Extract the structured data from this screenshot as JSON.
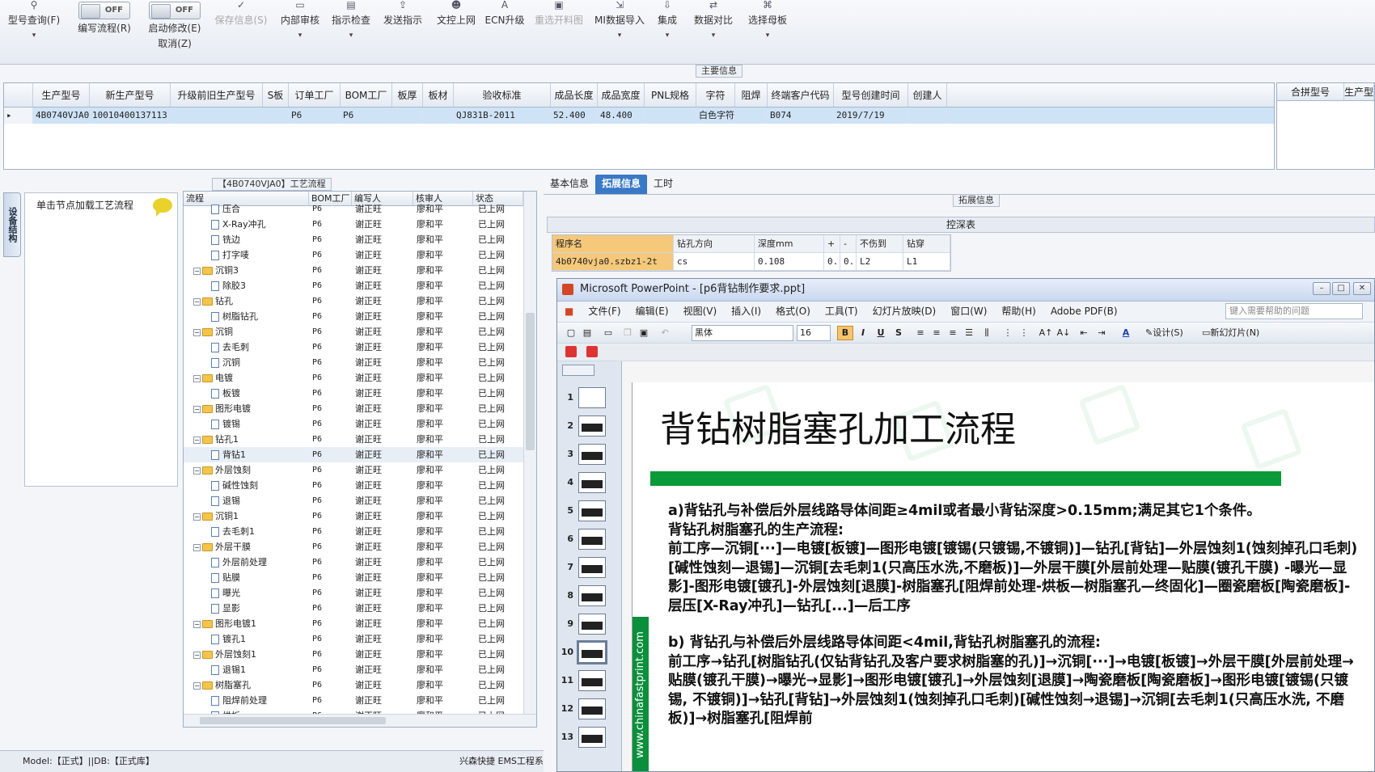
{
  "toolbar": {
    "items": [
      {
        "label": "型号查询(F)",
        "icon": "magnifier-icon",
        "arrow": "▾",
        "enabled": true
      },
      {
        "label": "编写流程(R)",
        "toggle": "OFF",
        "enabled": true
      },
      {
        "label": "启动修改(E)",
        "label2": "取消(Z)",
        "toggle": "OFF",
        "enabled": true
      },
      {
        "label": "保存信息(S)",
        "icon": "check-icon",
        "enabled": false
      },
      {
        "label": "内部审核",
        "icon": "printer-icon",
        "arrow": "▾",
        "enabled": true
      },
      {
        "label": "指示检查",
        "icon": "doc-check-icon",
        "arrow": "▾",
        "enabled": true
      },
      {
        "label": "发送指示",
        "icon": "upload-icon",
        "enabled": true
      },
      {
        "label": "文控上网",
        "icon": "users-icon",
        "enabled": true
      },
      {
        "label": "ECN升级",
        "icon": "letter-a-icon",
        "enabled": true
      },
      {
        "label": "重选开料图",
        "icon": "image-icon",
        "enabled": false
      },
      {
        "label": "MI数据导入",
        "icon": "import-icon",
        "arrow": "▾",
        "enabled": true
      },
      {
        "label": "集成",
        "icon": "download-icon",
        "arrow": "▾",
        "enabled": true
      },
      {
        "label": "数据对比",
        "icon": "compare-icon",
        "arrow": "▾",
        "enabled": true
      },
      {
        "label": "选择母板",
        "icon": "tree-icon",
        "arrow": "▾",
        "enabled": true
      }
    ]
  },
  "main_info": {
    "title": "主要信息",
    "columns": [
      "生产型号",
      "新生产型号",
      "升级前旧生产型号",
      "S板",
      "订单工厂",
      "BOM工厂",
      "板厚",
      "板材",
      "验收标准",
      "成品长度",
      "成品宽度",
      "PNL规格",
      "字符",
      "阻焊",
      "终端客户代码",
      "型号创建时间",
      "创建人"
    ],
    "row": [
      "4B0740VJA0",
      "10010400137113",
      "",
      "",
      "P6",
      "P6",
      "",
      "",
      "QJ831B-2011",
      "52.400",
      "48.400",
      "",
      "白色字符",
      "",
      "B074",
      "2019/7/19",
      ""
    ],
    "side_columns": [
      "合拼型号",
      "生产型"
    ]
  },
  "flow": {
    "title": "【4B0740VJA0】工艺流程",
    "side_tab": "设备结构",
    "hint": "单击节点加载工艺流程",
    "columns": [
      "流程",
      "BOM工厂",
      "编写人",
      "核审人",
      "状态"
    ],
    "rows": [
      {
        "name": "压合",
        "type": "doc",
        "level": 2,
        "bom": "P6",
        "writer": "谢正旺",
        "reviewer": "廖和平",
        "status": "已上网"
      },
      {
        "name": "X-Ray冲孔",
        "type": "doc",
        "level": 2,
        "bom": "P6",
        "writer": "谢正旺",
        "reviewer": "廖和平",
        "status": "已上网"
      },
      {
        "name": "铣边",
        "type": "doc",
        "level": 2,
        "bom": "P6",
        "writer": "谢正旺",
        "reviewer": "廖和平",
        "status": "已上网"
      },
      {
        "name": "打字唛",
        "type": "doc",
        "level": 2,
        "bom": "P6",
        "writer": "谢正旺",
        "reviewer": "廖和平",
        "status": "已上网"
      },
      {
        "name": "沉铜3",
        "type": "folder",
        "level": 1,
        "bom": "P6",
        "writer": "谢正旺",
        "reviewer": "廖和平",
        "status": "已上网"
      },
      {
        "name": "除胶3",
        "type": "doc",
        "level": 2,
        "bom": "P6",
        "writer": "谢正旺",
        "reviewer": "廖和平",
        "status": "已上网"
      },
      {
        "name": "钻孔",
        "type": "folder",
        "level": 1,
        "bom": "P6",
        "writer": "谢正旺",
        "reviewer": "廖和平",
        "status": "已上网"
      },
      {
        "name": "树脂钻孔",
        "type": "doc",
        "level": 2,
        "bom": "P6",
        "writer": "谢正旺",
        "reviewer": "廖和平",
        "status": "已上网"
      },
      {
        "name": "沉铜",
        "type": "folder",
        "level": 1,
        "bom": "P6",
        "writer": "谢正旺",
        "reviewer": "廖和平",
        "status": "已上网"
      },
      {
        "name": "去毛刺",
        "type": "doc",
        "level": 2,
        "bom": "P6",
        "writer": "谢正旺",
        "reviewer": "廖和平",
        "status": "已上网"
      },
      {
        "name": "沉铜",
        "type": "doc",
        "level": 2,
        "bom": "P6",
        "writer": "谢正旺",
        "reviewer": "廖和平",
        "status": "已上网"
      },
      {
        "name": "电镀",
        "type": "folder",
        "level": 1,
        "bom": "P6",
        "writer": "谢正旺",
        "reviewer": "廖和平",
        "status": "已上网"
      },
      {
        "name": "板镀",
        "type": "doc",
        "level": 2,
        "bom": "P6",
        "writer": "谢正旺",
        "reviewer": "廖和平",
        "status": "已上网"
      },
      {
        "name": "图形电镀",
        "type": "folder",
        "level": 1,
        "bom": "P6",
        "writer": "谢正旺",
        "reviewer": "廖和平",
        "status": "已上网"
      },
      {
        "name": "镀锡",
        "type": "doc",
        "level": 2,
        "bom": "P6",
        "writer": "谢正旺",
        "reviewer": "廖和平",
        "status": "已上网"
      },
      {
        "name": "钻孔1",
        "type": "folder",
        "level": 1,
        "bom": "P6",
        "writer": "谢正旺",
        "reviewer": "廖和平",
        "status": "已上网"
      },
      {
        "name": "背钻1",
        "type": "doc",
        "level": 2,
        "bom": "P6",
        "writer": "谢正旺",
        "reviewer": "廖和平",
        "status": "已上网",
        "selected": true
      },
      {
        "name": "外层蚀刻",
        "type": "folder",
        "level": 1,
        "bom": "P6",
        "writer": "谢正旺",
        "reviewer": "廖和平",
        "status": "已上网"
      },
      {
        "name": "碱性蚀刻",
        "type": "doc",
        "level": 2,
        "bom": "P6",
        "writer": "谢正旺",
        "reviewer": "廖和平",
        "status": "已上网"
      },
      {
        "name": "退锡",
        "type": "doc",
        "level": 2,
        "bom": "P6",
        "writer": "谢正旺",
        "reviewer": "廖和平",
        "status": "已上网"
      },
      {
        "name": "沉铜1",
        "type": "folder",
        "level": 1,
        "bom": "P6",
        "writer": "谢正旺",
        "reviewer": "廖和平",
        "status": "已上网"
      },
      {
        "name": "去毛刺1",
        "type": "doc",
        "level": 2,
        "bom": "P6",
        "writer": "谢正旺",
        "reviewer": "廖和平",
        "status": "已上网"
      },
      {
        "name": "外层干膜",
        "type": "folder",
        "level": 1,
        "bom": "P6",
        "writer": "谢正旺",
        "reviewer": "廖和平",
        "status": "已上网"
      },
      {
        "name": "外层前处理",
        "type": "doc",
        "level": 2,
        "bom": "P6",
        "writer": "谢正旺",
        "reviewer": "廖和平",
        "status": "已上网"
      },
      {
        "name": "贴膜",
        "type": "doc",
        "level": 2,
        "bom": "P6",
        "writer": "谢正旺",
        "reviewer": "廖和平",
        "status": "已上网"
      },
      {
        "name": "曝光",
        "type": "doc",
        "level": 2,
        "bom": "P6",
        "writer": "谢正旺",
        "reviewer": "廖和平",
        "status": "已上网"
      },
      {
        "name": "显影",
        "type": "doc",
        "level": 2,
        "bom": "P6",
        "writer": "谢正旺",
        "reviewer": "廖和平",
        "status": "已上网"
      },
      {
        "name": "图形电镀1",
        "type": "folder",
        "level": 1,
        "bom": "P6",
        "writer": "谢正旺",
        "reviewer": "廖和平",
        "status": "已上网"
      },
      {
        "name": "镀孔1",
        "type": "doc",
        "level": 2,
        "bom": "P6",
        "writer": "谢正旺",
        "reviewer": "廖和平",
        "status": "已上网"
      },
      {
        "name": "外层蚀刻1",
        "type": "folder",
        "level": 1,
        "bom": "P6",
        "writer": "谢正旺",
        "reviewer": "廖和平",
        "status": "已上网"
      },
      {
        "name": "退锡1",
        "type": "doc",
        "level": 2,
        "bom": "P6",
        "writer": "谢正旺",
        "reviewer": "廖和平",
        "status": "已上网"
      },
      {
        "name": "树脂塞孔",
        "type": "folder",
        "level": 1,
        "bom": "P6",
        "writer": "谢正旺",
        "reviewer": "廖和平",
        "status": "已上网"
      },
      {
        "name": "阻焊前处理",
        "type": "doc",
        "level": 2,
        "bom": "P6",
        "writer": "谢正旺",
        "reviewer": "廖和平",
        "status": "已上网"
      },
      {
        "name": "烘板",
        "type": "doc",
        "level": 2,
        "bom": "P6",
        "writer": "谢正旺",
        "reviewer": "廖和平",
        "status": "已上网"
      }
    ]
  },
  "status_bar": {
    "left": "Model:【正式】||DB:【正式库】",
    "right": "兴森快捷  EMS工程系统"
  },
  "detail": {
    "tabs": [
      {
        "label": "基本信息",
        "active": false
      },
      {
        "label": "拓展信息",
        "active": true
      },
      {
        "label": "工时",
        "active": false
      }
    ],
    "section_title": "拓展信息",
    "table_title": "控深表",
    "columns": [
      "程序名",
      "钻孔方向",
      "深度mm",
      "+",
      "-",
      "不伤到",
      "钻穿"
    ],
    "row": [
      "4b0740vja0.szbz1-2t",
      "cs",
      "0.108",
      "0.",
      "0.",
      "L2",
      "L1"
    ]
  },
  "ppt": {
    "title": "Microsoft PowerPoint - [p6背钻制作要求.ppt]",
    "menus": [
      "文件(F)",
      "编辑(E)",
      "视图(V)",
      "插入(I)",
      "格式(O)",
      "工具(T)",
      "幻灯片放映(D)",
      "窗口(W)",
      "帮助(H)",
      "Adobe PDF(B)"
    ],
    "ask_placeholder": "键入需要帮助的问题",
    "font": "黑体",
    "font_size": "16",
    "format_buttons": {
      "bold": "B",
      "italic": "I",
      "underline": "U",
      "shadow": "S"
    },
    "design_label": "设计(S)",
    "new_slide_label": "新幻灯片(N)",
    "thumbnails": [
      "1",
      "2",
      "3",
      "4",
      "5",
      "6",
      "7",
      "8",
      "9",
      "10",
      "11",
      "12",
      "13"
    ],
    "selected_thumb": "10",
    "slide": {
      "title": "背钻树脂塞孔加工流程",
      "watermark": "www.chinafastprint.com",
      "para_a": [
        "a)背钻孔与补偿后外层线路导体间距≥4mil或者最小背钻深度>0.15mm;满足其它1个条件。",
        "背钻孔树脂塞孔的生产流程:",
        "前工序—沉铜[···]—电镀[板镀]—图形电镀[镀锡(只镀锡,不镀铜)]—钻孔[背钻]—外层蚀刻1(蚀刻掉孔口毛刺)[碱性蚀刻—退锡]—沉铜[去毛刺1(只高压水洗,不磨板)]—外层干膜[外层前处理—贴膜(镀孔干膜) -曝光—显影]-图形电镀[镀孔]-外层蚀刻[退膜]-树脂塞孔[阻焊前处理-烘板—树脂塞孔—终固化]—圈瓷磨板[陶瓷磨板]-层压[X-Ray冲孔]—钻孔[...]—后工序"
      ],
      "para_b": [
        "b) 背钻孔与补偿后外层线路导体间距<4mil,背钻孔树脂塞孔的流程:",
        "前工序→钻孔[树脂钻孔(仅钻背钻孔及客户要求树脂塞的孔)]→沉铜[···]→电镀[板镀]→外层干膜[外层前处理→贴膜(镀孔干膜)→曝光→显影]→图形电镀[镀孔]→外层蚀刻[退膜]→陶瓷磨板[陶瓷磨板]→图形电镀[镀锡(只镀锡, 不镀铜)]→钻孔[背钻]→外层蚀刻1(蚀刻掉孔口毛刺)[碱性蚀刻→退锡]→沉铜[去毛刺1(只高压水洗, 不磨板)]→树脂塞孔[阻焊前"
      ]
    }
  },
  "colors": {
    "selection": "#cfe3f7",
    "tab_active": "#3a79c6",
    "slide_bar": "#0a9a3a",
    "highlight": "#f5c87a"
  }
}
